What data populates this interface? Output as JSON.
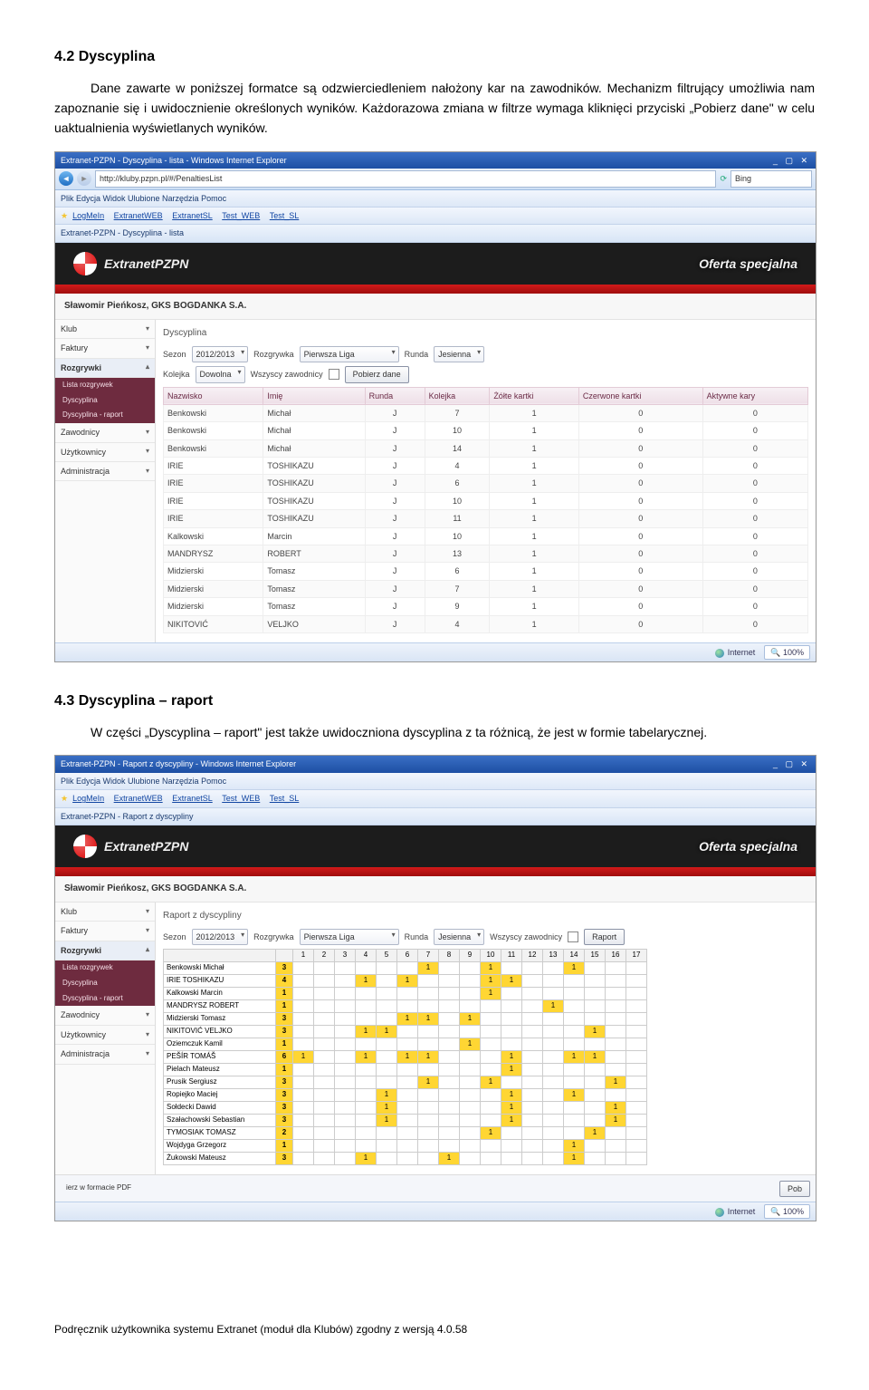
{
  "section42": {
    "heading": "4.2   Dyscyplina",
    "para": "Dane zawarte w poniższej formatce są odzwierciedleniem nałożony kar na zawodników. Mechanizm filtrujący umożliwia nam zapoznanie się i uwidocznienie określonych wyników. Każdorazowa zmiana w filtrze wymaga kliknięci przyciski „Pobierz dane\" w celu uaktualnienia wyświetlanych wyników."
  },
  "section43": {
    "heading": "4.3   Dyscyplina – raport",
    "para": "W części „Dyscyplina – raport\" jest także uwidoczniona dyscyplina z ta różnicą, że jest w formie tabelarycznej."
  },
  "shot1": {
    "title": "Extranet-PZPN - Dyscyplina - lista - Windows Internet Explorer",
    "url": "http://kluby.pzpn.pl/#/PenaltiesList",
    "search": "Bing",
    "menu": "Plik   Edycja   Widok   Ulubione   Narzędzia   Pomoc",
    "favs": [
      "LogMeIn",
      "ExtranetWEB",
      "ExtranetSL",
      "Test_WEB",
      "Test_SL"
    ],
    "tab": "Extranet-PZPN - Dyscyplina - lista",
    "bannerTitle": "ExtranetPZPN",
    "offer": "Oferta specjalna",
    "user": "Sławomir Pieńkosz, GKS BOGDANKA S.A.",
    "sidebar": {
      "klub": "Klub",
      "faktury": "Faktury",
      "rozgrywki": "Rozgrywki",
      "sub1": "Lista rozgrywek",
      "sub2": "Dyscyplina",
      "sub3": "Dyscyplina - raport",
      "zawodnicy": "Zawodnicy",
      "uzytkownicy": "Użytkownicy",
      "administracja": "Administracja"
    },
    "panelTitle": "Dyscyplina",
    "filters": {
      "sezonLabel": "Sezon",
      "sezon": "2012/2013",
      "rozgrywkaLabel": "Rozgrywka",
      "rozgrywka": "Pierwsza Liga",
      "rundaLabel": "Runda",
      "runda": "Jesienna",
      "kolejkaLabel": "Kolejka",
      "kolejka": "Dowolna",
      "wszyscyLabel": "Wszyscy zawodnicy",
      "pobierz": "Pobierz dane"
    },
    "cols": [
      "Nazwisko",
      "Imię",
      "Runda",
      "Kolejka",
      "Żółte kartki",
      "Czerwone kartki",
      "Aktywne kary"
    ],
    "rows": [
      [
        "Benkowski",
        "Michał",
        "J",
        "7",
        "1",
        "0",
        "0"
      ],
      [
        "Benkowski",
        "Michał",
        "J",
        "10",
        "1",
        "0",
        "0"
      ],
      [
        "Benkowski",
        "Michał",
        "J",
        "14",
        "1",
        "0",
        "0"
      ],
      [
        "IRIE",
        "TOSHIKAZU",
        "J",
        "4",
        "1",
        "0",
        "0"
      ],
      [
        "IRIE",
        "TOSHIKAZU",
        "J",
        "6",
        "1",
        "0",
        "0"
      ],
      [
        "IRIE",
        "TOSHIKAZU",
        "J",
        "10",
        "1",
        "0",
        "0"
      ],
      [
        "IRIE",
        "TOSHIKAZU",
        "J",
        "11",
        "1",
        "0",
        "0"
      ],
      [
        "Kalkowski",
        "Marcin",
        "J",
        "10",
        "1",
        "0",
        "0"
      ],
      [
        "MANDRYSZ",
        "ROBERT",
        "J",
        "13",
        "1",
        "0",
        "0"
      ],
      [
        "Midzierski",
        "Tomasz",
        "J",
        "6",
        "1",
        "0",
        "0"
      ],
      [
        "Midzierski",
        "Tomasz",
        "J",
        "7",
        "1",
        "0",
        "0"
      ],
      [
        "Midzierski",
        "Tomasz",
        "J",
        "9",
        "1",
        "0",
        "0"
      ],
      [
        "NIKITOVIĆ",
        "VELJKO",
        "J",
        "4",
        "1",
        "0",
        "0"
      ]
    ],
    "status": {
      "net": "Internet",
      "zoom": "100%"
    }
  },
  "shot2": {
    "title": "Extranet-PZPN - Raport z dyscypliny - Windows Internet Explorer",
    "tab": "Extranet-PZPN - Raport z dyscypliny",
    "panelTitle": "Raport z dyscypliny",
    "raportBtn": "Raport",
    "pdf": "ierz w formacie PDF",
    "cols": [
      "",
      "",
      "1",
      "2",
      "3",
      "4",
      "5",
      "6",
      "7",
      "8",
      "9",
      "10",
      "11",
      "12",
      "13",
      "14",
      "15",
      "16",
      "17"
    ],
    "rows": [
      {
        "name": "Benkowski Michał",
        "total": "3",
        "y": [
          7,
          10,
          14
        ]
      },
      {
        "name": "IRIE TOSHIKAZU",
        "total": "4",
        "y": [
          4,
          6,
          10,
          11
        ]
      },
      {
        "name": "Kalkowski Marcin",
        "total": "1",
        "y": [
          10
        ]
      },
      {
        "name": "MANDRYSZ ROBERT",
        "total": "1",
        "y": [
          13
        ]
      },
      {
        "name": "Midzierski Tomasz",
        "total": "3",
        "y": [
          6,
          7,
          9
        ]
      },
      {
        "name": "NIKITOVIĆ VELJKO",
        "total": "3",
        "y": [
          4,
          5,
          15
        ]
      },
      {
        "name": "Oziemczuk Kamil",
        "total": "1",
        "y": [
          9
        ]
      },
      {
        "name": "PEŠÍR TOMÁŠ",
        "total": "6",
        "y": [
          1,
          4,
          6,
          7,
          11,
          14,
          15
        ]
      },
      {
        "name": "Pielach Mateusz",
        "total": "1",
        "y": [
          11
        ]
      },
      {
        "name": "Prusik Sergiusz",
        "total": "3",
        "y": [
          7,
          10,
          16
        ]
      },
      {
        "name": "Ropiejko Maciej",
        "total": "3",
        "y": [
          5,
          11,
          14
        ]
      },
      {
        "name": "Sołdecki Dawid",
        "total": "3",
        "y": [
          5,
          11,
          16
        ]
      },
      {
        "name": "Szałachowski Sebastian",
        "total": "3",
        "y": [
          5,
          11,
          16
        ]
      },
      {
        "name": "TYMOSIAK TOMASZ",
        "total": "2",
        "y": [
          10,
          15
        ]
      },
      {
        "name": "Wojdyga Grzegorz",
        "total": "1",
        "y": [
          14
        ]
      },
      {
        "name": "Żukowski Mateusz",
        "total": "3",
        "y": [
          4,
          8,
          14
        ]
      }
    ],
    "pob": "Pob",
    "status": {
      "net": "Internet",
      "zoom": "100%"
    }
  },
  "footer": "Podręcznik użytkownika systemu Extranet (moduł dla Klubów) zgodny z wersją 4.0.58"
}
